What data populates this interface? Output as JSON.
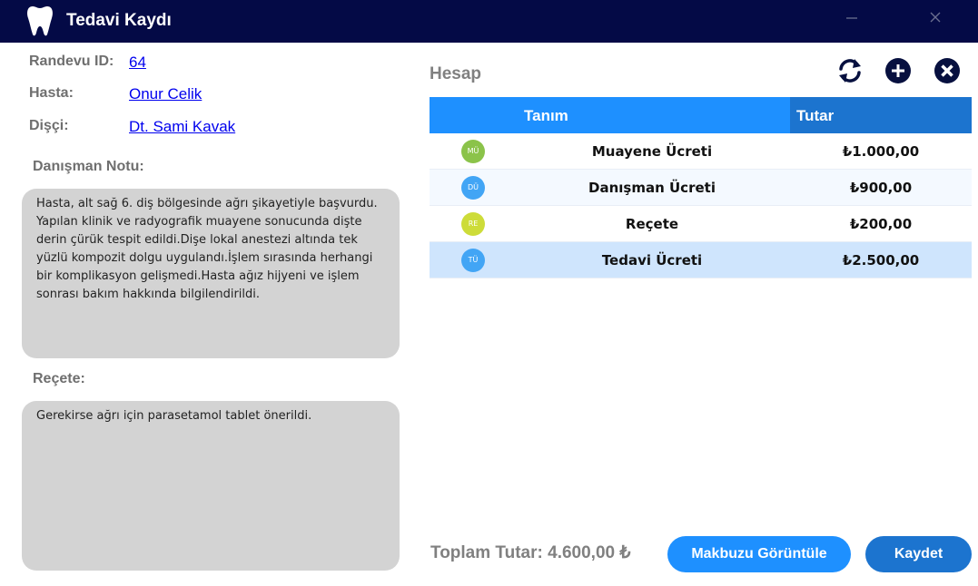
{
  "window": {
    "title": "Tedavi Kaydı"
  },
  "details": {
    "appointment_label": "Randevu ID:",
    "appointment_value": "64",
    "patient_label": "Hasta:",
    "patient_value": "Onur Celik",
    "dentist_label": "Dişçi:",
    "dentist_value": "Dt. Sami Kavak"
  },
  "consultant_note": {
    "label": "Danışman Notu:",
    "text": "Hasta, alt sağ 6. diş bölgesinde ağrı şikayetiyle başvurdu. Yapılan klinik ve radyografik muayene sonucunda dişte derin çürük tespit edildi.Dişe lokal anestezi altında tek yüzlü kompozit dolgu uygulandı.İşlem sırasında herhangi bir komplikasyon gelişmedi.Hasta ağız hijyeni ve işlem sonrası bakım hakkında bilgilendirildi."
  },
  "prescription": {
    "label": "Reçete:",
    "text": "Gerekirse ağrı için parasetamol tablet önerildi."
  },
  "account": {
    "title": "Hesap",
    "toolbar_icons": [
      "refresh-icon",
      "add-icon",
      "delete-icon"
    ],
    "columns": [
      "Tanım",
      "Tutar"
    ],
    "rows": [
      {
        "badge": "MÜ",
        "badge_color": "#8bc34a",
        "name": "Muayene Ücreti",
        "amount": "₺1.000,00",
        "row_bg": "#ffffff"
      },
      {
        "badge": "DÜ",
        "badge_color": "#42a5f5",
        "name": "Danışman Ücreti",
        "amount": "₺900,00",
        "row_bg": "#f4f9ff"
      },
      {
        "badge": "RE",
        "badge_color": "#cddc39",
        "name": "Reçete",
        "amount": "₺200,00",
        "row_bg": "#ffffff"
      },
      {
        "badge": "TÜ",
        "badge_color": "#42a5f5",
        "name": "Tedavi Ücreti",
        "amount": "₺2.500,00",
        "row_bg": "#cfe5fd"
      }
    ]
  },
  "footer": {
    "total": "Toplam Tutar: 4.600,00 ₺",
    "receipt_button": "Makbuzu Görüntüle",
    "save_button": "Kaydet"
  },
  "colors": {
    "titlebar": "#040a46",
    "header_primary": "#1e90ff",
    "header_secondary": "#1c74cf",
    "receipt_button": "#1e90ff",
    "save_button": "#1c74cf",
    "note_background": "#d3d3d3"
  }
}
